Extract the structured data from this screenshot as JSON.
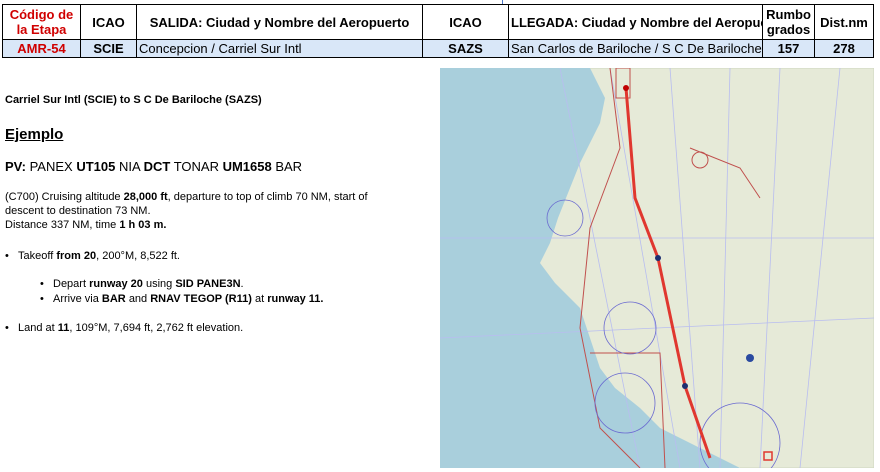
{
  "table": {
    "headers": {
      "codigo": "Código de la Etapa",
      "icao_dep": "ICAO",
      "salida": "SALIDA: Ciudad y Nombre del Aeropuerto",
      "icao_arr": "ICAO",
      "llegada": "LLEGADA: Ciudad y Nombre del Aeropuerto",
      "rumbo": "Rumbo grados",
      "dist": "Dist.nm"
    },
    "row": {
      "codigo": "AMR-54",
      "icao_dep": "SCIE",
      "salida": "Concepcion / Carriel Sur Intl",
      "icao_arr": "SAZS",
      "llegada": "San Carlos de Bariloche / S C De Bariloche",
      "rumbo": "157",
      "dist": "278"
    }
  },
  "briefing": {
    "title": "Carriel Sur Intl (SCIE) to S C De Bariloche (SAZS)",
    "ejemplo": "Ejemplo",
    "pv": {
      "label": "PV:",
      "parts": [
        "PANEX",
        "UT105",
        "NIA",
        "DCT",
        "TONAR",
        "UM1658",
        "BAR"
      ]
    },
    "cruise": {
      "pre": "(C700) Cruising altitude",
      "altitude": "28,000 ft",
      "mid": ", departure to top of climb 70 NM, start of descent to destination 73 NM.",
      "distance_pre": "Distance 337 NM, time",
      "time": "1 h 03 m."
    },
    "takeoff": {
      "pre": "Takeoff",
      "from": "from 20",
      "post": ", 200°M, 8,522 ft."
    },
    "depart": {
      "pre": "Depart",
      "runway": "runway 20",
      "mid": "using",
      "sid": "SID PANE3N",
      "end": "."
    },
    "arrive": {
      "pre": "Arrive via",
      "bar": "BAR",
      "and": "and",
      "rnav": "RNAV TEGOP (R11)",
      "at": "at",
      "runway": "runway 11."
    },
    "land": {
      "pre": "Land at",
      "rwy": "11",
      "post": ", 109°M, 7,694 ft, 2,762 ft elevation."
    }
  },
  "colors": {
    "header_red": "#d00000",
    "row_bg": "#d9e7f8",
    "sea": "#a9cfdc",
    "land": "#e6ead8",
    "route": "#e0372f"
  }
}
